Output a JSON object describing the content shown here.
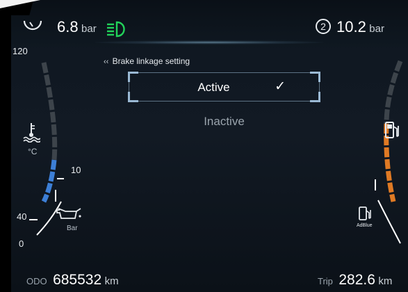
{
  "top": {
    "pressure1": {
      "value": "6.8",
      "unit": "bar"
    },
    "pressure2": {
      "circuit": "2",
      "value": "10.2",
      "unit": "bar"
    }
  },
  "left_gauge": {
    "scale_top": "120",
    "coolant_unit": "°C",
    "mark_10": "10",
    "mark_40": "40",
    "mark_0": "0",
    "oil_unit": "Bar"
  },
  "right_gauge": {
    "adblue_label": "AdBlue"
  },
  "menu": {
    "back_icon": "back-chevron",
    "title": "Brake linkage setting",
    "options": [
      {
        "label": "Active",
        "selected": true,
        "check": "✓"
      },
      {
        "label": "Inactive",
        "selected": false
      }
    ]
  },
  "odometer": {
    "label": "ODO",
    "value": "685532",
    "unit": "km"
  },
  "trip": {
    "label": "Trip",
    "value": "282.6",
    "unit": "km"
  },
  "colors": {
    "coolant_fill": "#3d7fd6",
    "fuel_fill": "#e07a24",
    "headlight_icon": "#22d25a",
    "scale_tick": "#3d444b"
  }
}
